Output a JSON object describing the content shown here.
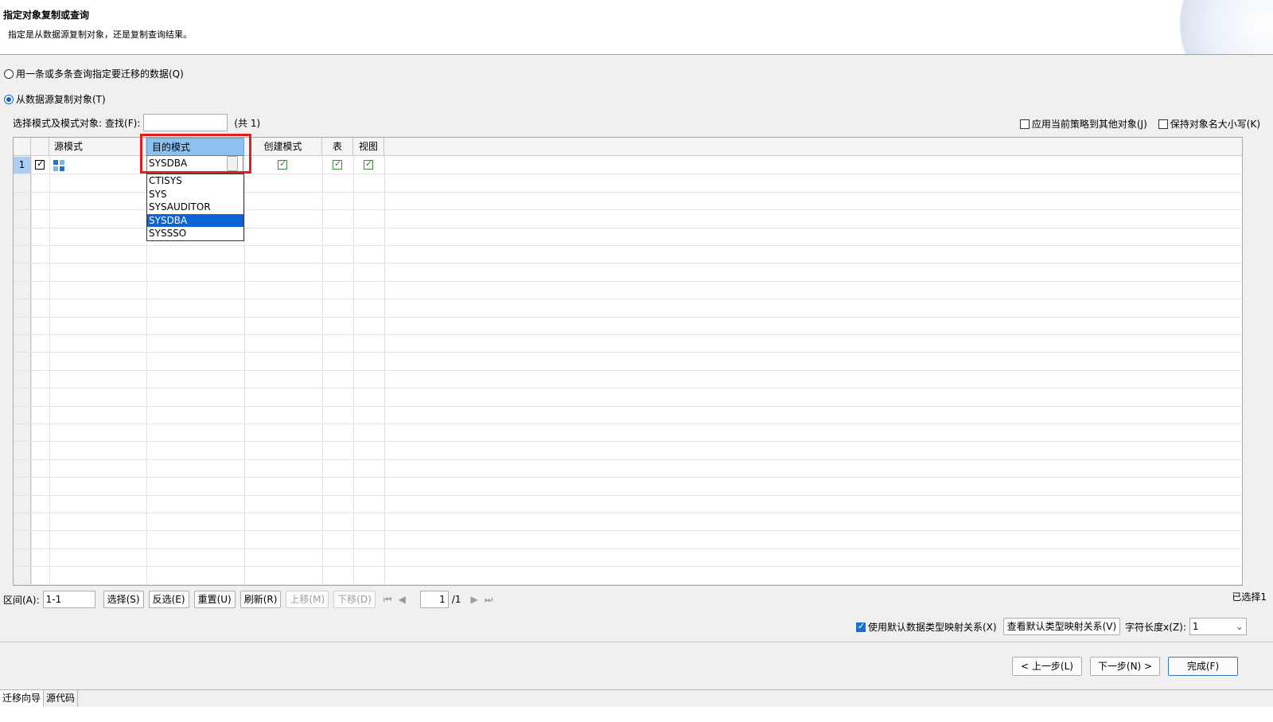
{
  "header": {
    "title": "指定对象复制或查询",
    "description": "指定是从数据源复制对象，还是复制查询结果。"
  },
  "options": {
    "query_label": "用一条或多条查询指定要迁移的数据(Q)",
    "copy_label": "从数据源复制对象(T)"
  },
  "filter": {
    "label": "选择模式及模式对象:",
    "search_label": "查找(F):",
    "search_value": "",
    "count": "(共 1)",
    "apply_strategy": "应用当前策略到其他对象(J)",
    "keep_case": "保持对象名大小写(K)"
  },
  "grid": {
    "columns": [
      "源模式",
      "目的模式",
      "创建模式",
      "表",
      "视图"
    ],
    "rows": [
      {
        "num": "1",
        "checked": true,
        "source": "",
        "target": "SYSDBA",
        "create_schema": true,
        "table": true,
        "view": true
      }
    ]
  },
  "dropdown": {
    "options": [
      "CTISYS",
      "SYS",
      "SYSAUDITOR",
      "SYSDBA",
      "SYSSSO"
    ],
    "selected": "SYSDBA"
  },
  "toolbar": {
    "range_label": "区间(A):",
    "range_value": "1-1",
    "select": "选择(S)",
    "invert": "反选(E)",
    "reset": "重置(U)",
    "refresh": "刷新(R)",
    "move_up": "上移(M)",
    "move_down": "下移(D)",
    "page_value": "1",
    "page_total": "/1",
    "selected_count": "已选择1"
  },
  "mapping": {
    "use_default": "使用默认数据类型映射关系(X)",
    "view_default": "查看默认类型映射关系(V)",
    "char_len_label": "字符长度x(Z):",
    "char_len_value": "1"
  },
  "footer": {
    "prev": "< 上一步(L)",
    "next": "下一步(N) >",
    "finish": "完成(F)"
  },
  "tabs": [
    "迁移向导",
    "源代码"
  ]
}
